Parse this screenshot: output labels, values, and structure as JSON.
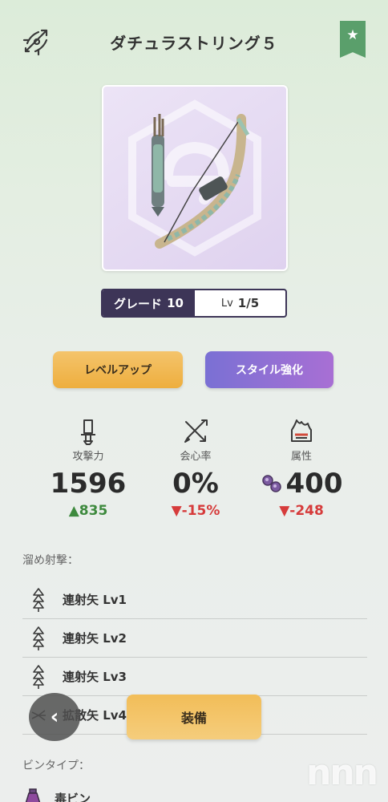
{
  "header": {
    "title": "ダチュラストリング５",
    "weapon_type_icon": "bow-type-icon",
    "favorite_icon": "star-icon"
  },
  "weapon": {
    "image_icon": "bow-weapon-image"
  },
  "grade": {
    "label": "グレード",
    "value": "10",
    "lv_prefix": "Lv",
    "lv_value": "1/5"
  },
  "actions": {
    "level_up": "レベルアップ",
    "style_upgrade": "スタイル強化"
  },
  "stats": [
    {
      "icon": "sword-icon",
      "label": "攻撃力",
      "value": "1596",
      "diff": "▲835",
      "trend": "up"
    },
    {
      "icon": "crossed-blades-icon",
      "label": "会心率",
      "value": "0%",
      "diff": "▼-15%",
      "trend": "down"
    },
    {
      "icon": "element-flame-icon",
      "label": "属性",
      "value": "400",
      "diff": "▼-248",
      "trend": "down",
      "value_icon": "poison-bubble-icon"
    }
  ],
  "charge_shot": {
    "label": "溜め射撃：",
    "items": [
      {
        "icon": "rapid-arrow-icon",
        "label": "連射矢 Lv1"
      },
      {
        "icon": "rapid-arrow-icon",
        "label": "連射矢 Lv2"
      },
      {
        "icon": "rapid-arrow-icon",
        "label": "連射矢 Lv3"
      },
      {
        "icon": "spread-arrow-icon",
        "label": "拡散矢 Lv4"
      }
    ]
  },
  "pin_type": {
    "label": "ビンタイプ：",
    "item": {
      "icon": "poison-vial-icon",
      "label": "毒ビン"
    }
  },
  "footer": {
    "back_icon": "chevron-left-icon",
    "back_glyph": "‹",
    "equip": "装備"
  },
  "watermark": "nnn",
  "colors": {
    "grade_bg": "#3d3557",
    "level_up": "#f0b54c",
    "style_upgrade": "#8f70d4",
    "favorite": "#5a9f6b",
    "up": "#3e8a3e",
    "down": "#d63b3b"
  }
}
